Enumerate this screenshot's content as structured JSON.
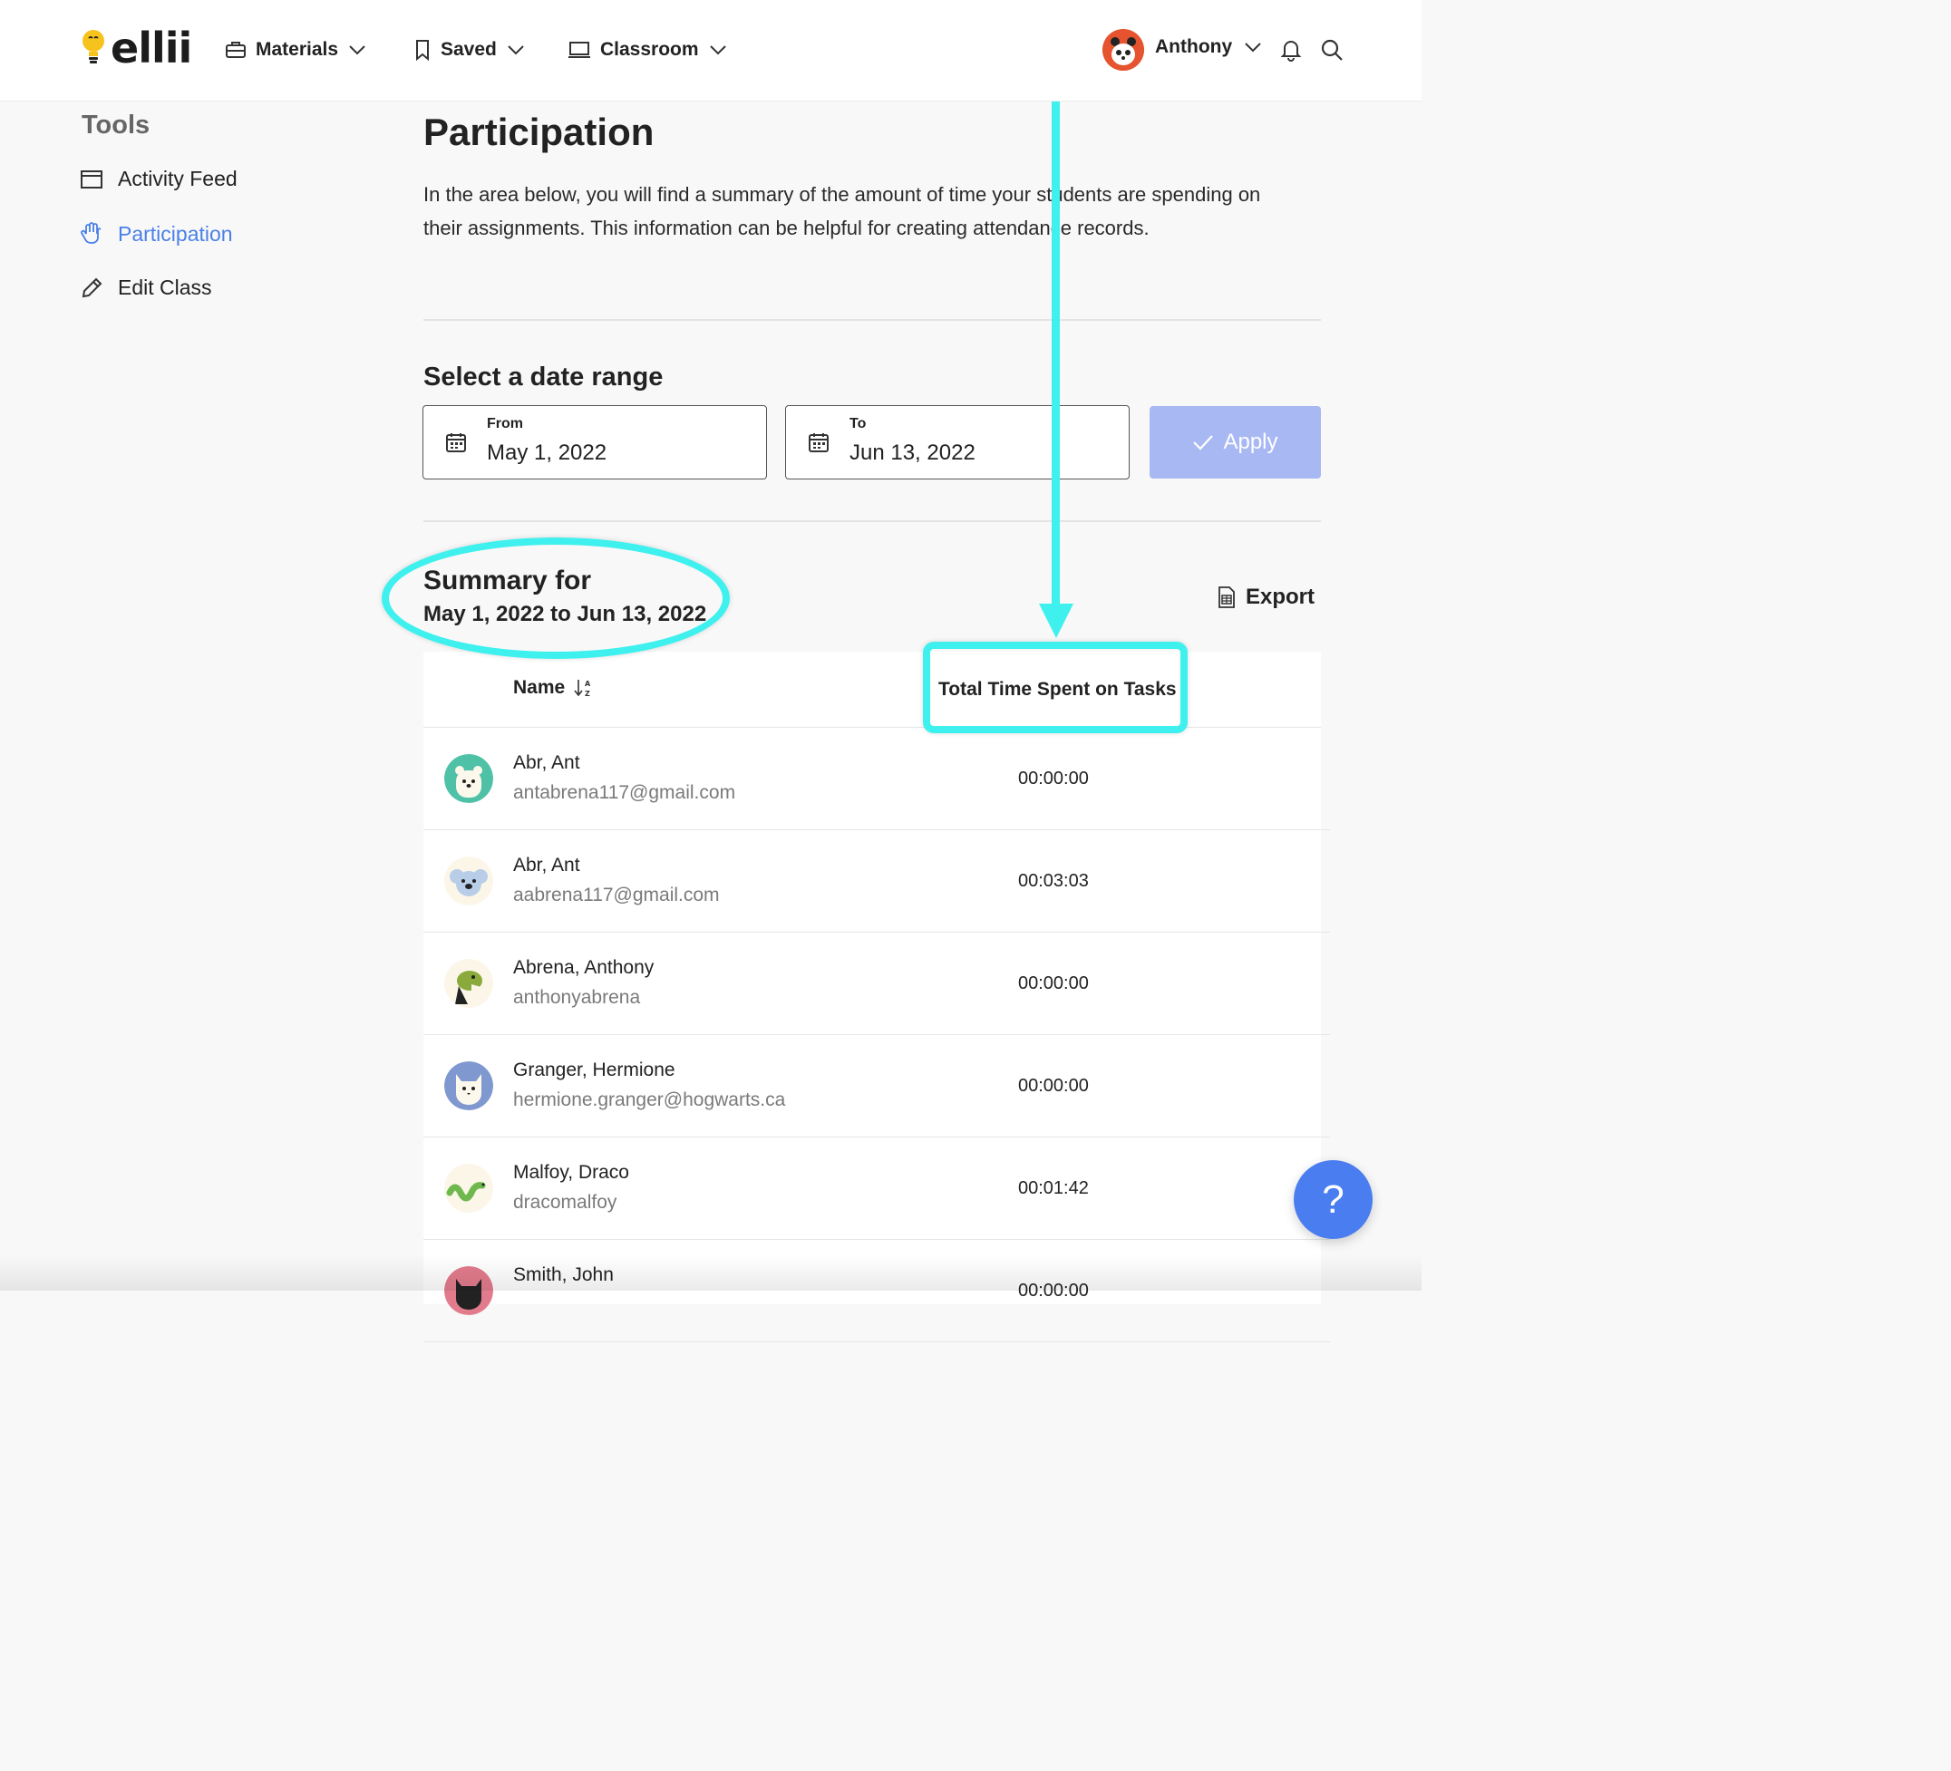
{
  "header": {
    "logo_text": "ellii",
    "nav": [
      {
        "label": "Materials",
        "icon": "briefcase-icon"
      },
      {
        "label": "Saved",
        "icon": "bookmark-icon"
      },
      {
        "label": "Classroom",
        "icon": "laptop-icon"
      }
    ],
    "user": {
      "name": "Anthony",
      "avatar": "panda-avatar"
    }
  },
  "sidebar": {
    "title": "Tools",
    "items": [
      {
        "label": "Activity Feed",
        "icon": "calendar-icon",
        "active": false
      },
      {
        "label": "Participation",
        "icon": "hand-icon",
        "active": true
      },
      {
        "label": "Edit Class",
        "icon": "pencil-icon",
        "active": false
      }
    ]
  },
  "main": {
    "title": "Participation",
    "intro": "In the area below, you will find a summary of the amount of time your students are spending on their assignments. This information can be helpful for creating attendance records.",
    "date_range": {
      "title": "Select a date range",
      "from_label": "From",
      "from_value": "May 1, 2022",
      "to_label": "To",
      "to_value": "Jun 13, 2022",
      "apply_label": "Apply"
    },
    "summary": {
      "heading": "Summary for",
      "range": "May 1, 2022 to Jun 13, 2022",
      "export_label": "Export"
    },
    "table": {
      "columns": {
        "name": "Name",
        "time": "Total Time Spent on Tasks"
      },
      "rows": [
        {
          "name": "Abr, Ant",
          "email": "antabrena117@gmail.com",
          "time": "00:00:00",
          "avatar": "bear-avatar"
        },
        {
          "name": "Abr, Ant",
          "email": "aabrena117@gmail.com",
          "time": "00:03:03",
          "avatar": "koala-avatar"
        },
        {
          "name": "Abrena, Anthony",
          "email": "anthonyabrena",
          "time": "00:00:00",
          "avatar": "dino-avatar"
        },
        {
          "name": "Granger, Hermione",
          "email": "hermione.granger@hogwarts.ca",
          "time": "00:00:00",
          "avatar": "cat-avatar"
        },
        {
          "name": "Malfoy, Draco",
          "email": "dracomalfoy",
          "time": "00:01:42",
          "avatar": "snake-avatar"
        },
        {
          "name": "Smith, John",
          "email": "",
          "time": "00:00:00",
          "avatar": "black-cat-avatar"
        }
      ]
    }
  },
  "help_label": "?",
  "colors": {
    "accent": "#4a80e8",
    "apply_bg": "#a8b8f3",
    "annotation": "#3ef0ee",
    "help_bg": "#4a7ef0"
  }
}
